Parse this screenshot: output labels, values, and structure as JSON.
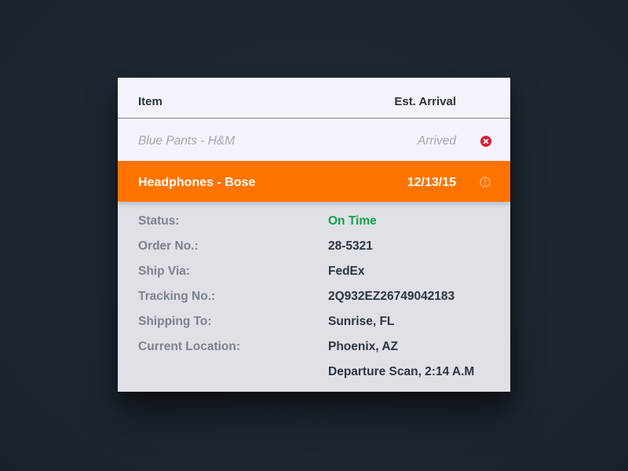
{
  "table": {
    "headers": {
      "item": "Item",
      "arrival": "Est. Arrival"
    },
    "rows": [
      {
        "name": "Blue Pants - H&M",
        "eta": "Arrived",
        "state": "arrived",
        "icon": "x-circle-icon"
      },
      {
        "name": "Headphones - Bose",
        "eta": "12/13/15",
        "state": "selected",
        "icon": "info-circle-icon"
      }
    ]
  },
  "details": {
    "status_label": "Status:",
    "status_value": "On Time",
    "order_label": "Order No.:",
    "order_value": "28-5321",
    "ship_label": "Ship Via:",
    "ship_value": "FedEx",
    "tracking_label": "Tracking No.:",
    "tracking_value": "2Q932EZ26749042183",
    "shipping_to_label": "Shipping To:",
    "shipping_to_value": "Sunrise, FL",
    "location_label": "Current Location:",
    "location_value": "Phoenix, AZ",
    "last_event_value": "Departure Scan, 2:14 A.M"
  },
  "colors": {
    "accent": "#ff7400",
    "status_ok": "#13a14a",
    "remove": "#e01b2d",
    "background": "#1e2731"
  }
}
